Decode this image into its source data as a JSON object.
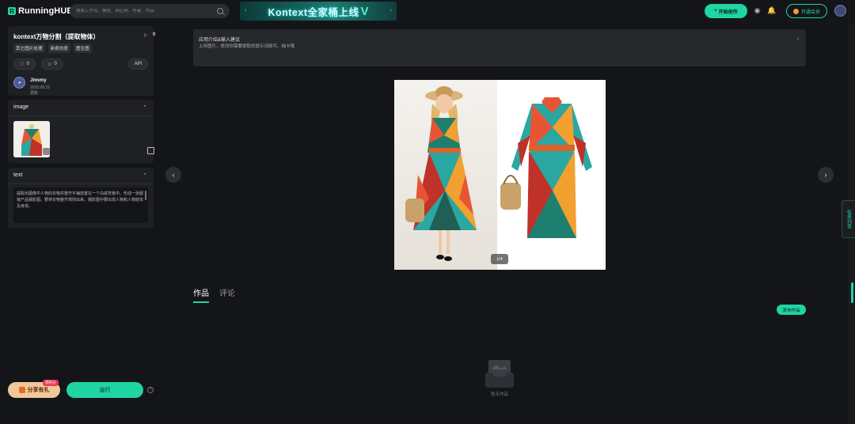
{
  "header": {
    "brand": "RunningHUB",
    "search_placeholder": "搜索工作流、模型、AI应用、作者、作品",
    "banner_text": "Kontext全家桶上线",
    "banner_accent": "V",
    "create_label": "开始创作",
    "vip_label": "开通会员"
  },
  "workflow": {
    "title": "kontext万物分割（提取物体）",
    "run_count": "0",
    "tags": [
      "其它图片处理",
      "新奇创意",
      "图生图"
    ],
    "likes": "0",
    "favorites": "0",
    "api_label": "API",
    "author": {
      "name": "Jimmy",
      "date": "2025.08.15 更新"
    }
  },
  "image_section": {
    "title": "image"
  },
  "text_section": {
    "title": "text",
    "value": "提取出图像中人物的衣物并整齐平铺放置在一个白底背景中。形成一张服装产品摄影图。要将衣物整齐规则出来。摄影图中要出现人物和人物肢体及身体。"
  },
  "bottom": {
    "share_label": "分享有礼",
    "share_badge": "得积分",
    "run_label": "运行",
    "help_label": "?"
  },
  "intro": {
    "title": "应用介绍&输入建议",
    "desc": "上传图片，修改你需要提取的提示词即可。抽卡哦"
  },
  "viewer": {
    "counter": "1/4"
  },
  "tabs": [
    {
      "label": "作品",
      "active": true
    },
    {
      "label": "评论",
      "active": false
    }
  ],
  "publish_label": "发布作品",
  "empty_text": "暂无作品",
  "side_tab_label": "任务列表",
  "colors": {
    "accent": "#1fd5a3",
    "bg": "#141518",
    "panel": "#1e2024"
  }
}
